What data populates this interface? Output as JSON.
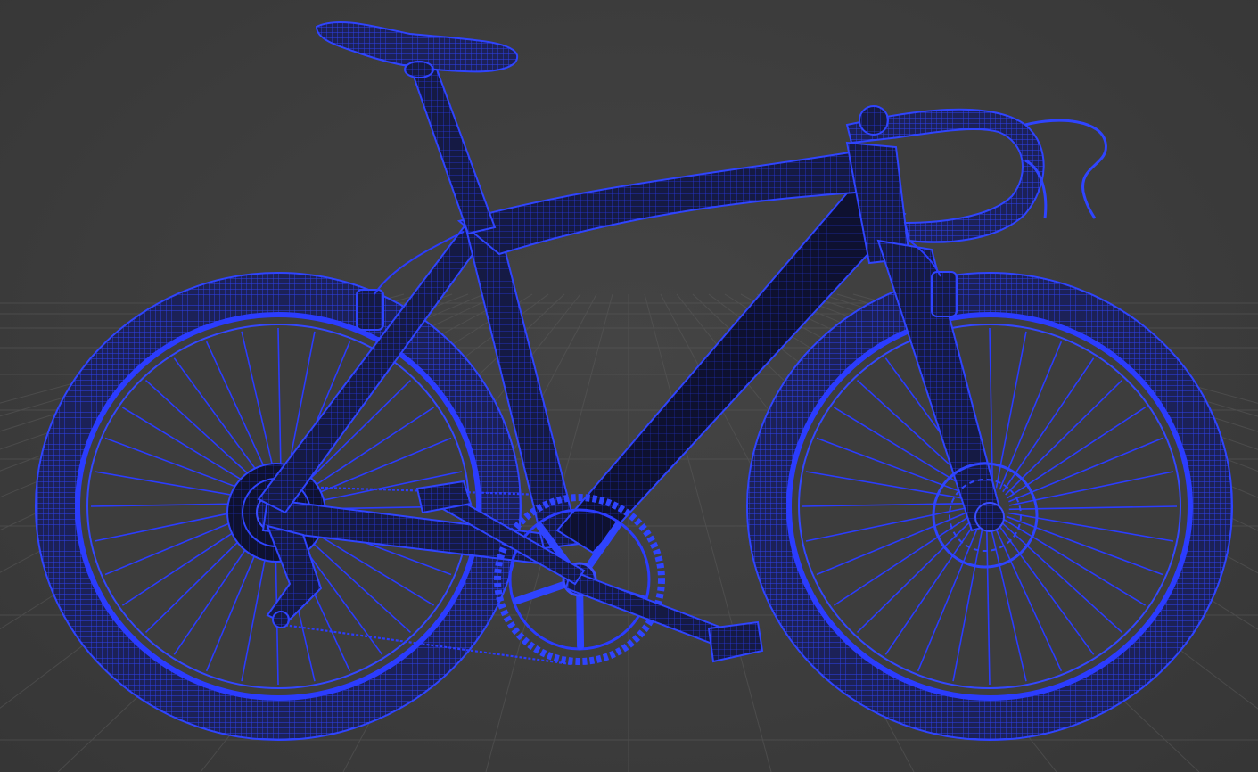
{
  "viewport": {
    "background_color": "#3d3d3d",
    "grid_color": "#5a5a5a",
    "grid": true
  },
  "model": {
    "object": "bicycle",
    "display_mode": "wireframe",
    "wire_color": "#2b3cff",
    "shade_color": "#0f1230",
    "frame_fill": "#121638",
    "tire_fill": "#1a1f4a",
    "parts": [
      "saddle-icon",
      "seatpost-icon",
      "handlebar-icon",
      "brake-lever-icon",
      "fork-icon",
      "front-wheel-icon",
      "rear-wheel-icon",
      "crankset-icon",
      "pedal-icon",
      "rear-derailleur-icon",
      "cassette-icon",
      "disc-brake-icon",
      "chain-icon"
    ]
  }
}
